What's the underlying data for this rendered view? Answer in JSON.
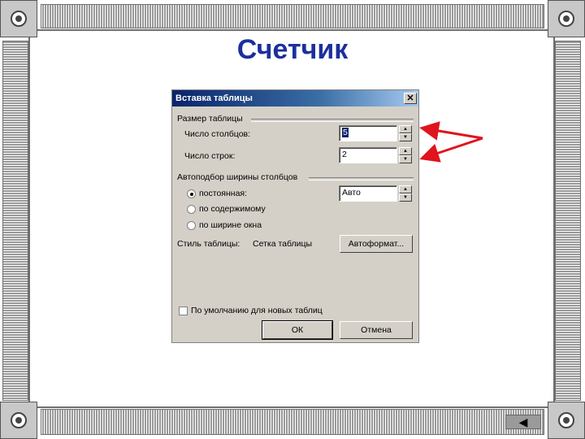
{
  "slide": {
    "title": "Счетчик",
    "nav_back_glyph": "◀"
  },
  "dialog": {
    "title": "Вставка таблицы",
    "close_glyph": "✕",
    "table_size": {
      "group_label": "Размер таблицы",
      "columns_label": "Число столбцов:",
      "columns_value": "5",
      "rows_label": "Число строк:",
      "rows_value": "2"
    },
    "autofit": {
      "group_label": "Автоподбор ширины столбцов",
      "options": [
        {
          "label": "постоянная:",
          "selected": true
        },
        {
          "label": "по содержимому",
          "selected": false
        },
        {
          "label": "по ширине окна",
          "selected": false
        }
      ],
      "width_value": "Авто"
    },
    "table_style": {
      "label": "Стиль таблицы:",
      "value": "Сетка таблицы",
      "autoformat_button": "Автоформат..."
    },
    "default_checkbox_label": "По умолчанию для новых таблиц",
    "ok_button": "ОК",
    "cancel_button": "Отмена"
  },
  "colors": {
    "title": "#1c2f9e",
    "arrow": "#e0141e",
    "dialog_face": "#d4d0c8",
    "titlebar_start": "#0a246a"
  },
  "icons": {
    "spin_up": "▲",
    "spin_down": "▼"
  }
}
